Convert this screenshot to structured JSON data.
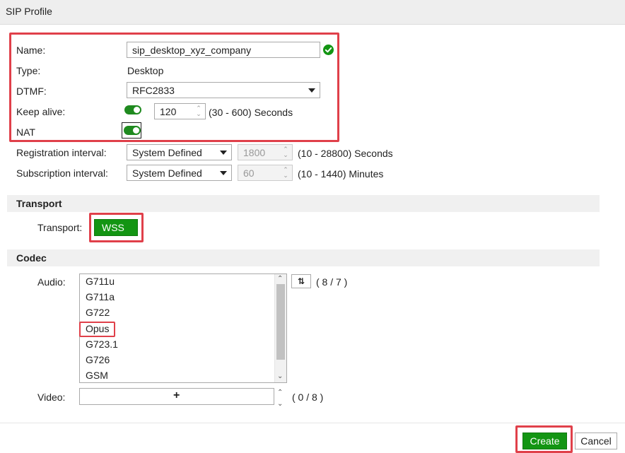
{
  "window": {
    "title": "SIP Profile"
  },
  "form": {
    "name": {
      "label": "Name:",
      "value": "sip_desktop_xyz_company"
    },
    "type": {
      "label": "Type:",
      "value": "Desktop"
    },
    "dtmf": {
      "label": "DTMF:",
      "value": "RFC2833"
    },
    "keep_alive": {
      "label": "Keep alive:",
      "enabled": true,
      "value": "120",
      "range": "(30 - 600) Seconds"
    },
    "nat": {
      "label": "NAT",
      "enabled": true
    },
    "registration_interval": {
      "label": "Registration interval:",
      "mode": "System Defined",
      "value": "1800",
      "range": "(10 - 28800) Seconds"
    },
    "subscription_interval": {
      "label": "Subscription interval:",
      "mode": "System Defined",
      "value": "60",
      "range": "(10 - 1440) Minutes"
    }
  },
  "transport": {
    "section_title": "Transport",
    "label": "Transport:",
    "value": "WSS"
  },
  "codec": {
    "section_title": "Codec",
    "audio": {
      "label": "Audio:",
      "items": [
        "G711u",
        "G711a",
        "G722",
        "Opus",
        "G723.1",
        "G726",
        "GSM"
      ],
      "count": "( 8 / 7 )"
    },
    "video": {
      "label": "Video:",
      "add_symbol": "+",
      "count": "( 0 / 8 )"
    }
  },
  "footer": {
    "create_label": "Create",
    "cancel_label": "Cancel"
  },
  "colors": {
    "accent_green": "#139513",
    "highlight_red": "#e0404a"
  }
}
